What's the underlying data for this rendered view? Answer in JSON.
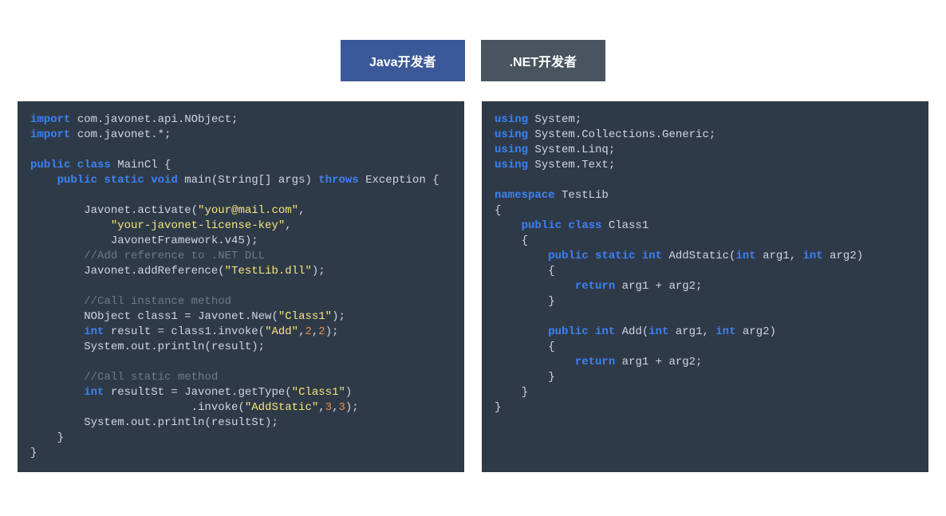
{
  "tabs": {
    "java": "Java开发者",
    "dotnet": ".NET开发者"
  },
  "java_code": {
    "l01a": "import",
    "l01b": " com.javonet.api.NObject;",
    "l02a": "import",
    "l02b": " com.javonet.*;",
    "l04a": "public class",
    "l04b": " MainCl {",
    "l05a": "    public static void",
    "l05b": " main(String[] args) ",
    "l05c": "throws",
    "l05d": " Exception {",
    "l07a": "        Javonet.activate(",
    "l07b": "\"your@mail.com\"",
    "l07c": ",",
    "l08a": "            ",
    "l08b": "\"your-javonet-license-key\"",
    "l08c": ",",
    "l09a": "            JavonetFramework.v45);",
    "l10a": "        //Add reference to .NET DLL",
    "l11a": "        Javonet.addReference(",
    "l11b": "\"TestLib.dll\"",
    "l11c": ");",
    "l13a": "        //Call instance method",
    "l14a": "        NObject class1 = Javonet.New(",
    "l14b": "\"Class1\"",
    "l14c": ");",
    "l15a": "        int",
    "l15b": " result = class1.invoke(",
    "l15c": "\"Add\"",
    "l15d": ",",
    "l15e": "2",
    "l15f": ",",
    "l15g": "2",
    "l15h": ");",
    "l16a": "        System.out.println(result);",
    "l18a": "        //Call static method",
    "l19a": "        int",
    "l19b": " resultSt = Javonet.getType(",
    "l19c": "\"Class1\"",
    "l19d": ")",
    "l20a": "                        .invoke(",
    "l20b": "\"AddStatic\"",
    "l20c": ",",
    "l20d": "3",
    "l20e": ",",
    "l20f": "3",
    "l20g": ");",
    "l21a": "        System.out.println(resultSt);",
    "l22a": "    }",
    "l23a": "}"
  },
  "cs_code": {
    "l01a": "using",
    "l01b": " System;",
    "l02a": "using",
    "l02b": " System.Collections.Generic;",
    "l03a": "using",
    "l03b": " System.Linq;",
    "l04a": "using",
    "l04b": " System.Text;",
    "l06a": "namespace",
    "l06b": " TestLib",
    "l07a": "{",
    "l08a": "    public class",
    "l08b": " Class1",
    "l09a": "    {",
    "l10a": "        public static int",
    "l10b": " AddStatic(",
    "l10c": "int",
    "l10d": " arg1, ",
    "l10e": "int",
    "l10f": " arg2)",
    "l11a": "        {",
    "l12a": "            return",
    "l12b": " arg1 + arg2;",
    "l13a": "        }",
    "l15a": "        public int",
    "l15b": " Add(",
    "l15c": "int",
    "l15d": " arg1, ",
    "l15e": "int",
    "l15f": " arg2)",
    "l16a": "        {",
    "l17a": "            return",
    "l17b": " arg1 + arg2;",
    "l18a": "        }",
    "l19a": "    }",
    "l20a": "}"
  }
}
